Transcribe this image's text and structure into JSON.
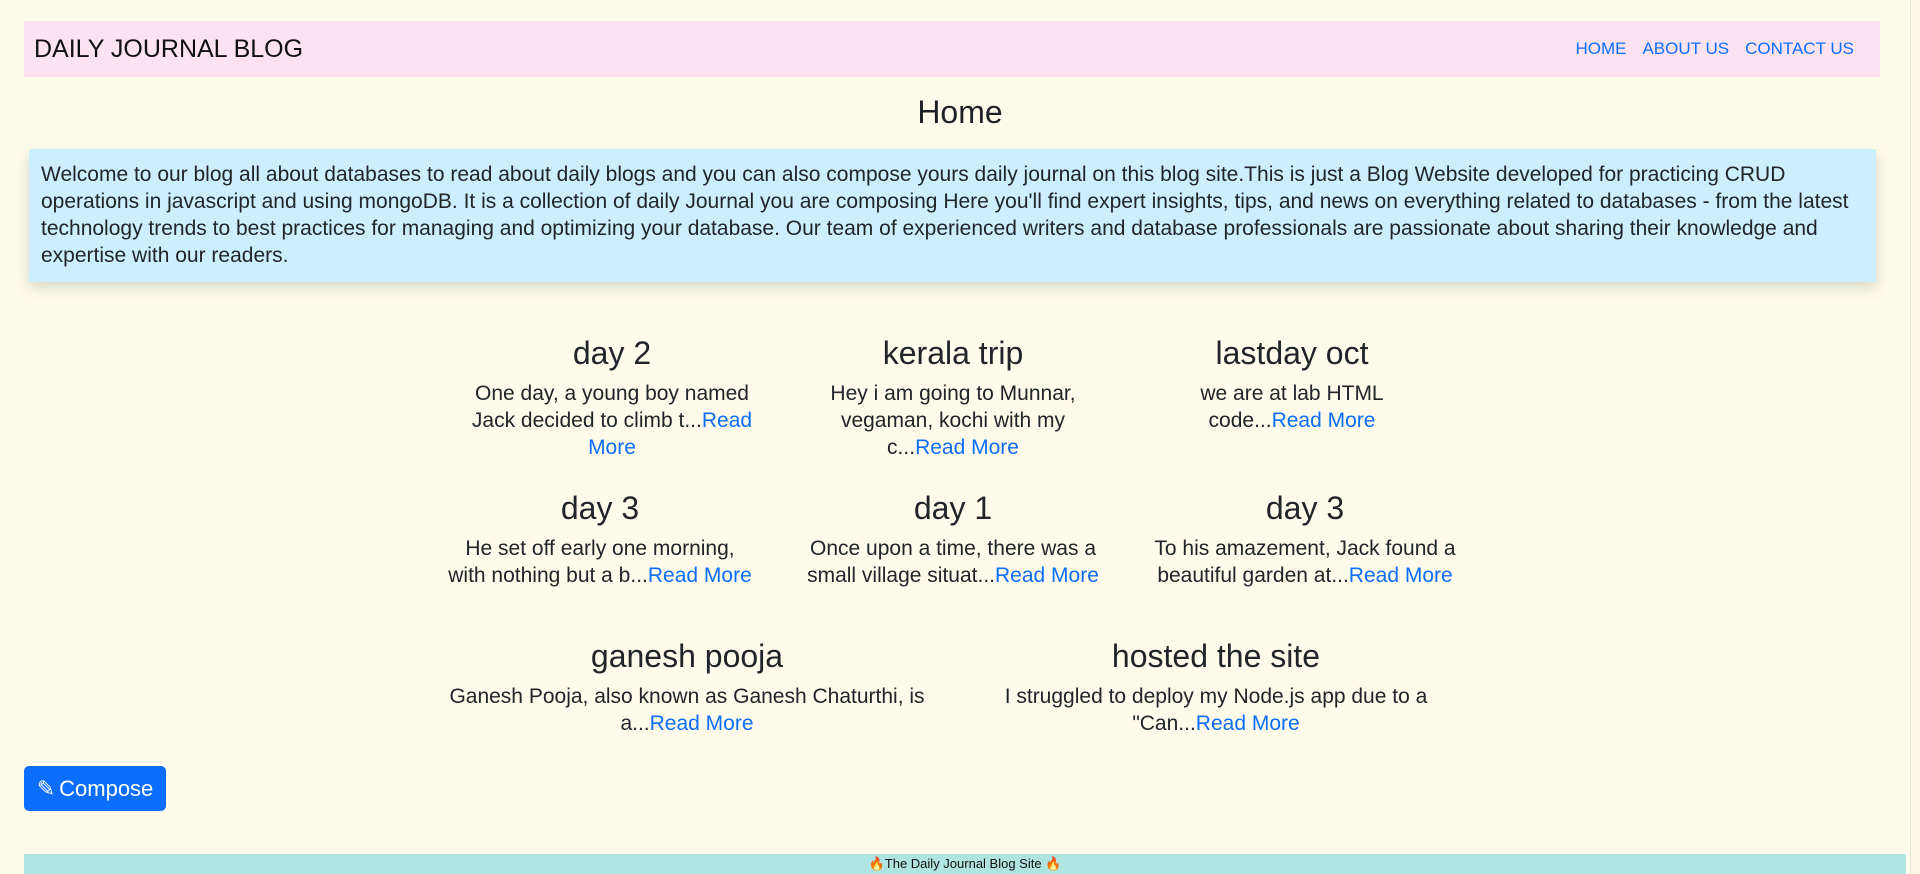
{
  "navbar": {
    "brand": "DAILY JOURNAL BLOG",
    "links": [
      "HOME",
      "ABOUT US",
      "CONTACT US"
    ]
  },
  "page": {
    "title": "Home",
    "intro": "Welcome to our blog all about databases to read about daily blogs and you can also compose yours daily journal on this blog site.This is just a Blog Website developed for practicing CRUD operations in javascript and using mongoDB. It is a collection of daily Journal you are composing Here you'll find expert insights, tips, and news on everything related to databases - from the latest technology trends to best practices for managing and optimizing your database. Our team of experienced writers and database professionals are passionate about sharing their knowledge and expertise with our readers."
  },
  "posts": [
    {
      "title": "day 2",
      "excerpt": "One day, a young boy named Jack decided to climb t...",
      "link": "Read More"
    },
    {
      "title": "kerala trip",
      "excerpt": "Hey i am going to Munnar, vegaman, kochi with my c...",
      "link": "Read More"
    },
    {
      "title": "lastday oct",
      "excerpt": "we are at lab HTML code...",
      "link": "Read More"
    },
    {
      "title": "day 3",
      "excerpt": "He set off early one morning, with nothing but a b...",
      "link": "Read More"
    },
    {
      "title": "day 1",
      "excerpt": "Once upon a time, there was a small village situat...",
      "link": "Read More"
    },
    {
      "title": "day 3",
      "excerpt": "To his amazement, Jack found a beautiful garden at...",
      "link": "Read More"
    },
    {
      "title": "ganesh pooja",
      "excerpt": "Ganesh Pooja, also known as Ganesh Chaturthi, is a...",
      "link": "Read More"
    },
    {
      "title": "hosted the site",
      "excerpt": "I struggled to deploy my Node.js app due to a \"Can...",
      "link": "Read More"
    }
  ],
  "compose": {
    "icon": "✎",
    "label": "Compose"
  },
  "footer": {
    "text": "🔥The Daily Journal Blog Site 🔥"
  }
}
